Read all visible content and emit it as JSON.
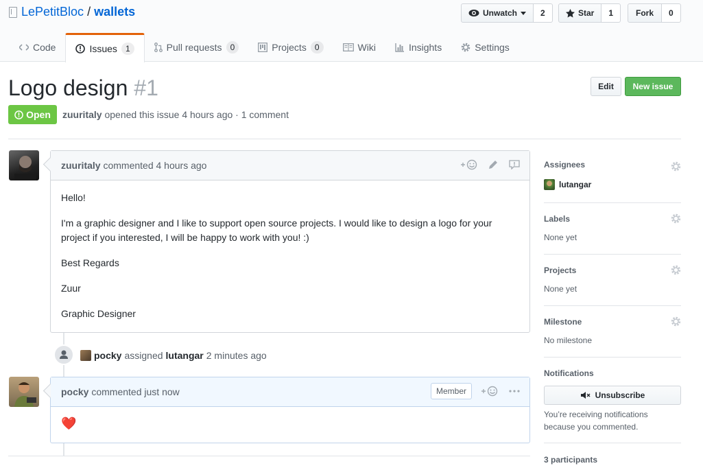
{
  "repo": {
    "owner": "LePetitBloc",
    "separator": "/",
    "name": "wallets"
  },
  "pagehead": {
    "watch_label": "Unwatch",
    "watch_count": "2",
    "star_label": "Star",
    "star_count": "1",
    "fork_label": "Fork",
    "fork_count": "0"
  },
  "tabs": [
    {
      "label": "Code",
      "icon": "code-icon"
    },
    {
      "label": "Issues",
      "count": "1",
      "icon": "issue-icon"
    },
    {
      "label": "Pull requests",
      "count": "0",
      "icon": "pull-request-icon"
    },
    {
      "label": "Projects",
      "count": "0",
      "icon": "project-icon"
    },
    {
      "label": "Wiki",
      "icon": "book-icon"
    },
    {
      "label": "Insights",
      "icon": "graph-icon"
    },
    {
      "label": "Settings",
      "icon": "gear-icon"
    }
  ],
  "issue": {
    "title": "Logo design",
    "number": "#1",
    "state": "Open",
    "author": "zuuritaly",
    "meta": "opened this issue 4 hours ago · 1 comment",
    "edit_label": "Edit",
    "new_issue_label": "New issue"
  },
  "comments": [
    {
      "author": "zuuritaly",
      "action": "commented 4 hours ago",
      "body": [
        "Hello!",
        "I'm a graphic designer and I like to support open source projects. I would like to design a logo for your project if you interested, I will be happy to work with you! :)",
        "Best Regards",
        "Zuur",
        "Graphic Designer"
      ]
    },
    {
      "author": "pocky",
      "action": "commented just now",
      "badge": "Member",
      "body": "❤️"
    }
  ],
  "event": {
    "actor": "pocky",
    "verb": "assigned",
    "target": "lutangar",
    "time": "2 minutes ago"
  },
  "sidebar": {
    "assignees_title": "Assignees",
    "assignee": "lutangar",
    "labels_title": "Labels",
    "labels_value": "None yet",
    "projects_title": "Projects",
    "projects_value": "None yet",
    "milestone_title": "Milestone",
    "milestone_value": "No milestone",
    "notifications_title": "Notifications",
    "unsubscribe_label": "Unsubscribe",
    "notifications_reason_1": "You’re receiving notifications",
    "notifications_reason_2": "because you commented.",
    "participants": "3 participants"
  },
  "colors": {
    "link": "#0366d6",
    "open": "#6cc644",
    "new_issue": "#5cb85c",
    "active_tab": "#e36209"
  }
}
